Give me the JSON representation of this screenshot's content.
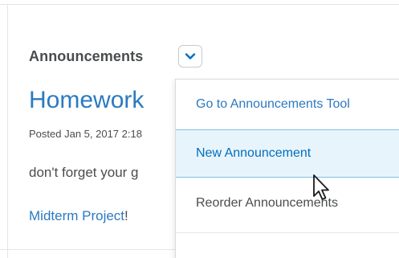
{
  "widget": {
    "title": "Announcements"
  },
  "announcement": {
    "title": "Homework",
    "posted": "Posted Jan 5, 2017 2:18",
    "body": "don't forget your g",
    "link_text": "Midterm Project",
    "link_suffix": "!"
  },
  "menu": {
    "items": [
      {
        "label": "Go to Announcements Tool"
      },
      {
        "label": "New Announcement",
        "state": "hover"
      },
      {
        "label": "Reorder Announcements"
      }
    ]
  },
  "colors": {
    "link_blue": "#2a7ac0",
    "hover_background": "#e8f4fb",
    "hover_border": "#7fc0e4",
    "text_gray": "#494c4e"
  },
  "icons": {
    "chevron": "chevron-down-icon",
    "cursor": "mouse-pointer-icon"
  }
}
